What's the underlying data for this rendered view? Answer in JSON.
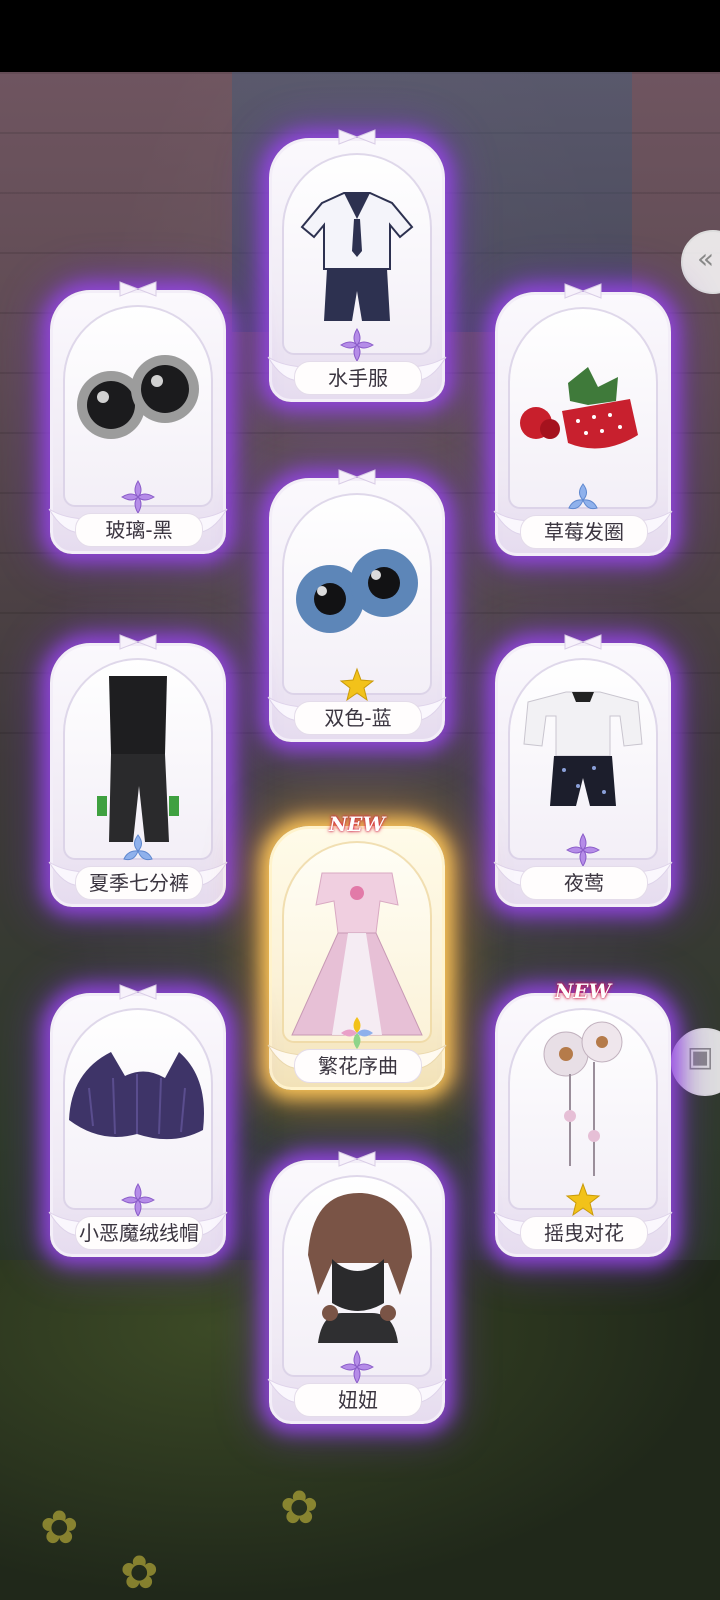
{
  "items": [
    {
      "name": "水手服",
      "rarity": "purple"
    },
    {
      "name": "玻璃-黑",
      "rarity": "purple"
    },
    {
      "name": "草莓发圈",
      "rarity": "blue"
    },
    {
      "name": "双色-蓝",
      "rarity": "gold"
    },
    {
      "name": "夏季七分裤",
      "rarity": "blue"
    },
    {
      "name": "夜莺",
      "rarity": "purple"
    },
    {
      "name": "繁花序曲",
      "rarity": "rainbow",
      "badge": "NEW"
    },
    {
      "name": "小恶魔绒线帽",
      "rarity": "purple"
    },
    {
      "name": "摇曳对花",
      "rarity": "gold",
      "badge": "NEW"
    },
    {
      "name": "妞妞",
      "rarity": "purple"
    }
  ],
  "colors": {
    "glow_purple": "#9646e6",
    "glow_gold": "#ffc85a",
    "gem_purple": "#b58ce8",
    "gem_blue": "#8fb1ec",
    "gem_gold": "#f2c21a"
  },
  "icons": {
    "side_top": "chevron-left-icon",
    "side_mid": "wardrobe-icon"
  }
}
